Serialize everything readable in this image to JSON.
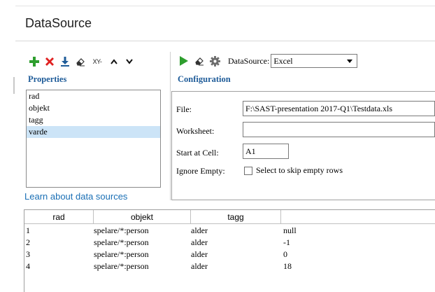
{
  "header": {
    "title": "DataSource"
  },
  "properties_toolbar": {
    "icons": [
      "add-icon",
      "delete-icon",
      "import-icon",
      "eraser-icon",
      "xy-icon",
      "move-up-icon",
      "move-down-icon"
    ],
    "xy_text": "XY-"
  },
  "properties": {
    "label": "Properties",
    "items": [
      {
        "label": "rad",
        "selected": false
      },
      {
        "label": "objekt",
        "selected": false
      },
      {
        "label": "tagg",
        "selected": false
      },
      {
        "label": "varde",
        "selected": true
      }
    ]
  },
  "learn_link": "Learn about data sources",
  "config_toolbar": {
    "icons": [
      "run-icon",
      "eraser-icon",
      "gear-icon"
    ],
    "datasource_label": "DataSource:",
    "datasource_value": "Excel"
  },
  "configuration": {
    "label": "Configuration",
    "file_label": "File:",
    "file_value": "F:\\SAST-presentation 2017-Q1\\Testdata.xls",
    "worksheet_label": "Worksheet:",
    "worksheet_value": "",
    "start_cell_label": "Start at Cell:",
    "start_cell_value": "A1",
    "ignore_empty_label": "Ignore Empty:",
    "ignore_empty_checkbox_label": "Select to skip empty rows",
    "ignore_empty_checked": false
  },
  "grid": {
    "columns": [
      "rad",
      "objekt",
      "tagg",
      ""
    ],
    "rows": [
      [
        "1",
        "spelare/*:person",
        "alder",
        "null"
      ],
      [
        "2",
        "spelare/*:person",
        "alder",
        "-1"
      ],
      [
        "3",
        "spelare/*:person",
        "alder",
        "0"
      ],
      [
        "4",
        "spelare/*:person",
        "alder",
        "18"
      ]
    ]
  },
  "colors": {
    "add": "#2e9e2e",
    "delete": "#e02020",
    "run": "#2e9e2e",
    "section_label": "#1f5c99",
    "link": "#1a6fb5",
    "selection": "#cce4f7"
  }
}
